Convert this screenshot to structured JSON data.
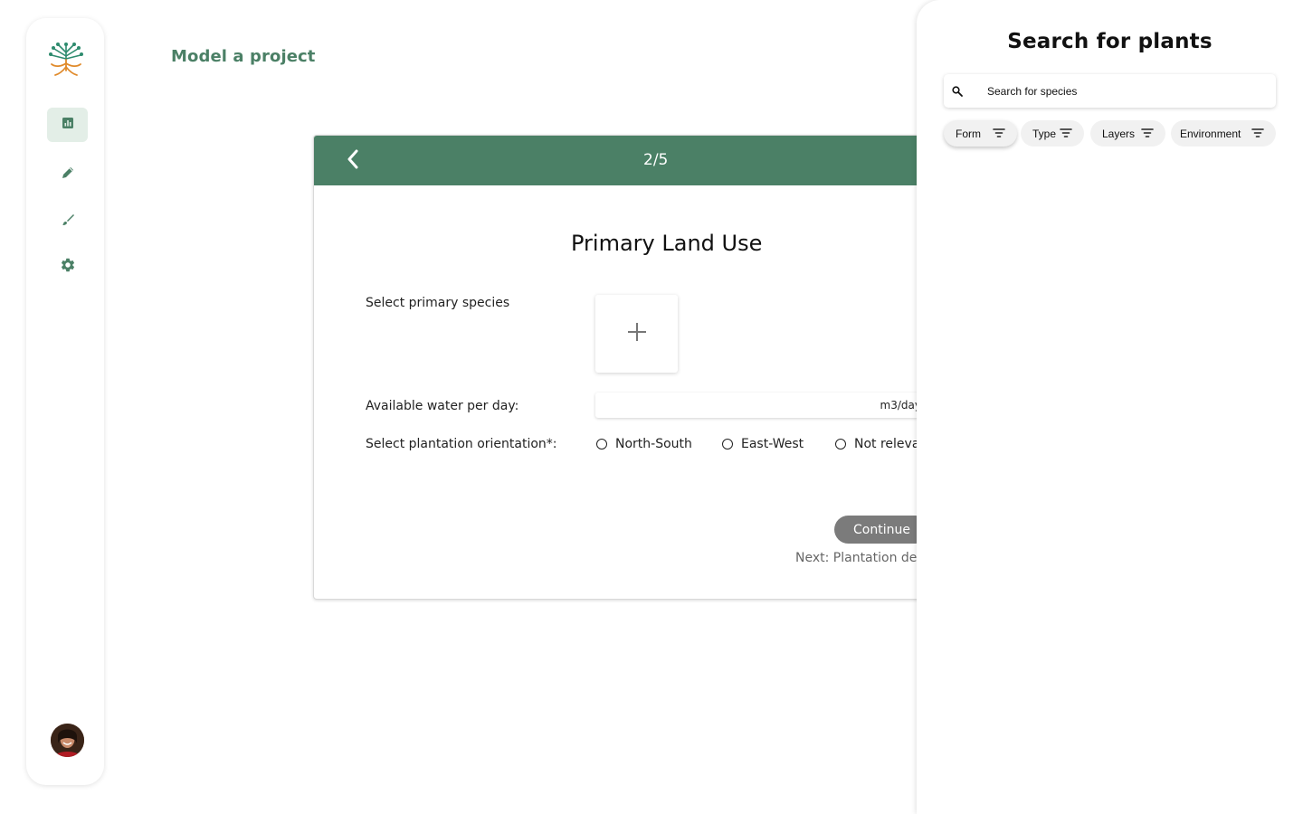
{
  "app": {
    "page_title": "Model a project",
    "nav": [
      {
        "icon": "dashboard-icon",
        "active": true
      },
      {
        "icon": "pencil-icon",
        "active": false
      },
      {
        "icon": "brush-icon",
        "active": false
      },
      {
        "icon": "gear-icon",
        "active": false
      }
    ],
    "colors": {
      "brand": "#4b8066",
      "nav_active_bg": "#e3eee7",
      "button_disabled": "#7b7b7b"
    }
  },
  "wizard": {
    "step": "2/5",
    "title": "Primary Land Use",
    "species_label": "Select primary species",
    "water_label": "Available water per day:",
    "water_value": "",
    "water_unit": "m3/day",
    "orientation_label": "Select plantation orientation*:",
    "orientation_options": [
      "North-South",
      "East-West",
      "Not relevant"
    ],
    "continue_label": "Continue",
    "next_label": "Next: Plantation design"
  },
  "plant_search": {
    "title": "Search for plants",
    "placeholder": "Search for species",
    "filters": [
      {
        "label": "Form",
        "active": true
      },
      {
        "label": "Type",
        "active": false
      },
      {
        "label": "Layers",
        "active": false
      },
      {
        "label": "Environment",
        "active": false
      }
    ]
  }
}
